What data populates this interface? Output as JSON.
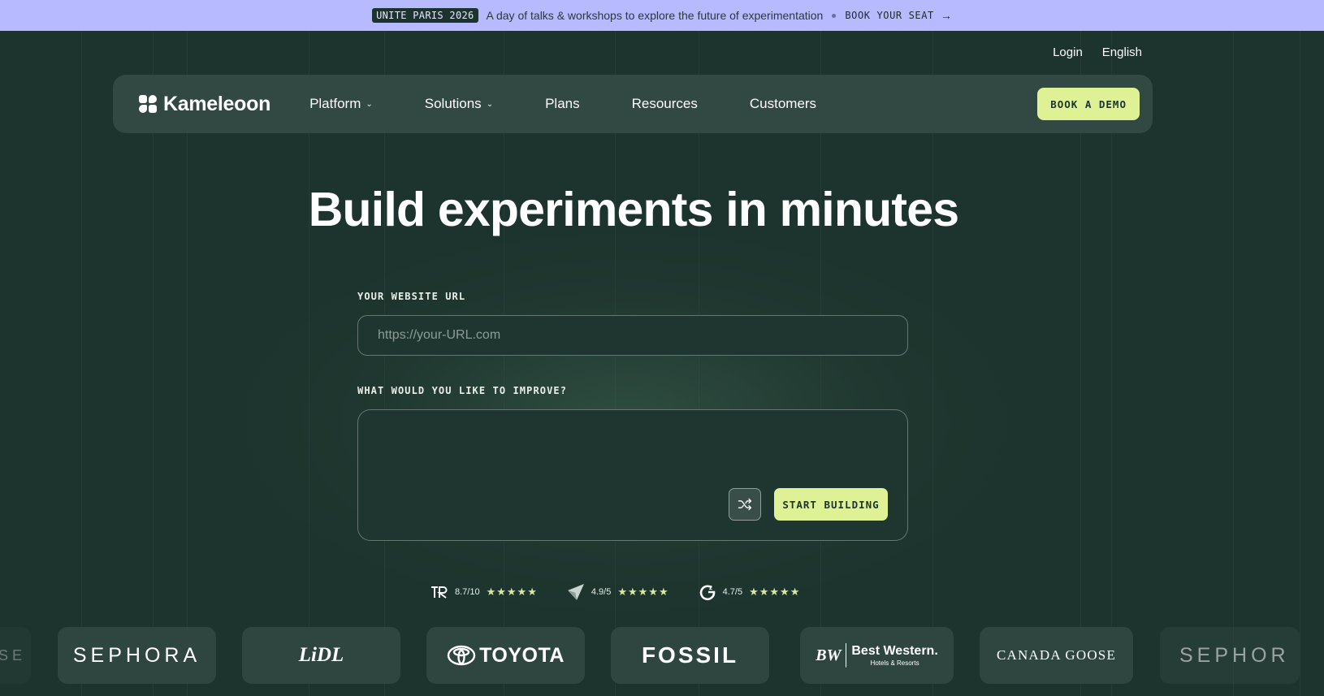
{
  "announcement": {
    "badge": "UNITE PARIS 2026",
    "text": "A day of talks & workshops to explore the future of experimentation",
    "cta": "BOOK YOUR SEAT",
    "arrow": "→"
  },
  "utility": {
    "login": "Login",
    "language": "English"
  },
  "nav": {
    "brand": "Kameleoon",
    "items": [
      {
        "label": "Platform",
        "chevron": "⌄"
      },
      {
        "label": "Solutions",
        "chevron": "⌄"
      },
      {
        "label": "Plans"
      },
      {
        "label": "Resources"
      },
      {
        "label": "Customers"
      }
    ],
    "demo": "BOOK A DEMO"
  },
  "hero": {
    "title": "Build experiments in minutes",
    "url_label": "YOUR WEBSITE URL",
    "url_placeholder": "https://your-URL.com",
    "improve_label": "WHAT WOULD YOU LIKE TO IMPROVE?",
    "start": "START BUILDING",
    "shuffle_icon": "shuffle-icon"
  },
  "ratings": [
    {
      "source": "trustradius",
      "score": "8.7/10",
      "stars": "★★★★★"
    },
    {
      "source": "capterra",
      "score": "4.9/5",
      "stars": "★★★★★"
    },
    {
      "source": "g2",
      "score": "4.7/5",
      "stars": "★★★★★"
    }
  ],
  "logos": {
    "partial_left": "SE",
    "sephora": "SEPHORA",
    "lidl": "LiDL",
    "toyota": "TOYOTA",
    "fossil": "FOSSIL",
    "bestwestern_mark": "BW",
    "bestwestern_name": "Best Western.",
    "bestwestern_sub": "Hotels & Resorts",
    "canada": "CANADA GOOSE",
    "partial_right": "SEPHOR"
  },
  "colors": {
    "background": "#1d332d",
    "announcement": "#b7baff",
    "accent": "#dff195",
    "card": "#2e4540"
  }
}
